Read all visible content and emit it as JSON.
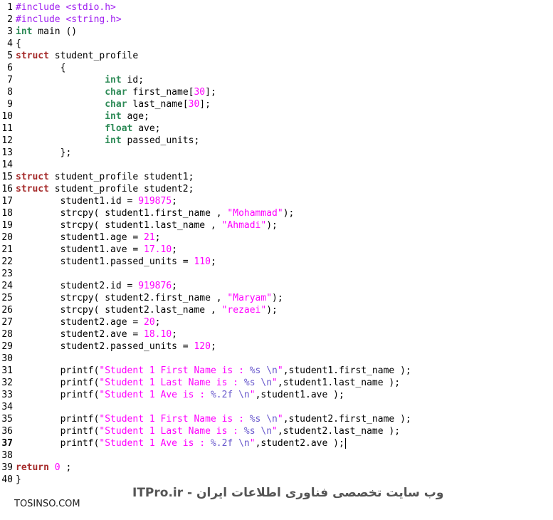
{
  "lines": [
    {
      "n": "1",
      "tokens": [
        {
          "t": "pre",
          "s": "#include <stdio.h>"
        }
      ]
    },
    {
      "n": "2",
      "tokens": [
        {
          "t": "pre",
          "s": "#include <string.h>"
        }
      ]
    },
    {
      "n": "3",
      "tokens": [
        {
          "t": "type",
          "s": "int"
        },
        {
          "t": "id",
          "s": " main ()"
        }
      ]
    },
    {
      "n": "4",
      "tokens": [
        {
          "t": "id",
          "s": "{"
        }
      ]
    },
    {
      "n": "5",
      "tokens": [
        {
          "t": "kw",
          "s": "struct"
        },
        {
          "t": "id",
          "s": " student_profile"
        }
      ]
    },
    {
      "n": "6",
      "tokens": [
        {
          "t": "id",
          "s": "        {"
        }
      ]
    },
    {
      "n": "7",
      "tokens": [
        {
          "t": "id",
          "s": "                "
        },
        {
          "t": "type",
          "s": "int"
        },
        {
          "t": "id",
          "s": " id;"
        }
      ]
    },
    {
      "n": "8",
      "tokens": [
        {
          "t": "id",
          "s": "                "
        },
        {
          "t": "type",
          "s": "char"
        },
        {
          "t": "id",
          "s": " first_name["
        },
        {
          "t": "num",
          "s": "30"
        },
        {
          "t": "id",
          "s": "];"
        }
      ]
    },
    {
      "n": "9",
      "tokens": [
        {
          "t": "id",
          "s": "                "
        },
        {
          "t": "type",
          "s": "char"
        },
        {
          "t": "id",
          "s": " last_name["
        },
        {
          "t": "num",
          "s": "30"
        },
        {
          "t": "id",
          "s": "];"
        }
      ]
    },
    {
      "n": "10",
      "tokens": [
        {
          "t": "id",
          "s": "                "
        },
        {
          "t": "type",
          "s": "int"
        },
        {
          "t": "id",
          "s": " age;"
        }
      ]
    },
    {
      "n": "11",
      "tokens": [
        {
          "t": "id",
          "s": "                "
        },
        {
          "t": "type",
          "s": "float"
        },
        {
          "t": "id",
          "s": " ave;"
        }
      ]
    },
    {
      "n": "12",
      "tokens": [
        {
          "t": "id",
          "s": "                "
        },
        {
          "t": "type",
          "s": "int"
        },
        {
          "t": "id",
          "s": " passed_units;"
        }
      ]
    },
    {
      "n": "13",
      "tokens": [
        {
          "t": "id",
          "s": "        };"
        }
      ]
    },
    {
      "n": "14",
      "tokens": []
    },
    {
      "n": "15",
      "tokens": [
        {
          "t": "kw",
          "s": "struct"
        },
        {
          "t": "id",
          "s": " student_profile student1;"
        }
      ]
    },
    {
      "n": "16",
      "tokens": [
        {
          "t": "kw",
          "s": "struct"
        },
        {
          "t": "id",
          "s": " student_profile student2;"
        }
      ]
    },
    {
      "n": "17",
      "tokens": [
        {
          "t": "id",
          "s": "        student1.id = "
        },
        {
          "t": "num",
          "s": "919875"
        },
        {
          "t": "id",
          "s": ";"
        }
      ]
    },
    {
      "n": "18",
      "tokens": [
        {
          "t": "id",
          "s": "        strcpy( student1.first_name , "
        },
        {
          "t": "str",
          "s": "\"Mohammad\""
        },
        {
          "t": "id",
          "s": ");"
        }
      ]
    },
    {
      "n": "19",
      "tokens": [
        {
          "t": "id",
          "s": "        strcpy( student1.last_name , "
        },
        {
          "t": "str",
          "s": "\"Ahmadi\""
        },
        {
          "t": "id",
          "s": ");"
        }
      ]
    },
    {
      "n": "20",
      "tokens": [
        {
          "t": "id",
          "s": "        student1.age = "
        },
        {
          "t": "num",
          "s": "21"
        },
        {
          "t": "id",
          "s": ";"
        }
      ]
    },
    {
      "n": "21",
      "tokens": [
        {
          "t": "id",
          "s": "        student1.ave = "
        },
        {
          "t": "num",
          "s": "17.10"
        },
        {
          "t": "id",
          "s": ";"
        }
      ]
    },
    {
      "n": "22",
      "tokens": [
        {
          "t": "id",
          "s": "        student1.passed_units = "
        },
        {
          "t": "num",
          "s": "110"
        },
        {
          "t": "id",
          "s": ";"
        }
      ]
    },
    {
      "n": "23",
      "tokens": []
    },
    {
      "n": "24",
      "tokens": [
        {
          "t": "id",
          "s": "        student2.id = "
        },
        {
          "t": "num",
          "s": "919876"
        },
        {
          "t": "id",
          "s": ";"
        }
      ]
    },
    {
      "n": "25",
      "tokens": [
        {
          "t": "id",
          "s": "        strcpy( student2.first_name , "
        },
        {
          "t": "str",
          "s": "\"Maryam\""
        },
        {
          "t": "id",
          "s": ");"
        }
      ]
    },
    {
      "n": "26",
      "tokens": [
        {
          "t": "id",
          "s": "        strcpy( student2.last_name , "
        },
        {
          "t": "str",
          "s": "\"rezaei\""
        },
        {
          "t": "id",
          "s": ");"
        }
      ]
    },
    {
      "n": "27",
      "tokens": [
        {
          "t": "id",
          "s": "        student2.age = "
        },
        {
          "t": "num",
          "s": "20"
        },
        {
          "t": "id",
          "s": ";"
        }
      ]
    },
    {
      "n": "28",
      "tokens": [
        {
          "t": "id",
          "s": "        student2.ave = "
        },
        {
          "t": "num",
          "s": "18.10"
        },
        {
          "t": "id",
          "s": ";"
        }
      ]
    },
    {
      "n": "29",
      "tokens": [
        {
          "t": "id",
          "s": "        student2.passed_units = "
        },
        {
          "t": "num",
          "s": "120"
        },
        {
          "t": "id",
          "s": ";"
        }
      ]
    },
    {
      "n": "30",
      "tokens": []
    },
    {
      "n": "31",
      "tokens": [
        {
          "t": "id",
          "s": "        printf("
        },
        {
          "t": "str",
          "s": "\"Student 1 First Name is : "
        },
        {
          "t": "esc",
          "s": "%s \\n"
        },
        {
          "t": "str",
          "s": "\""
        },
        {
          "t": "id",
          "s": ",student1.first_name );"
        }
      ]
    },
    {
      "n": "32",
      "tokens": [
        {
          "t": "id",
          "s": "        printf("
        },
        {
          "t": "str",
          "s": "\"Student 1 Last Name is : "
        },
        {
          "t": "esc",
          "s": "%s \\n"
        },
        {
          "t": "str",
          "s": "\""
        },
        {
          "t": "id",
          "s": ",student1.last_name );"
        }
      ]
    },
    {
      "n": "33",
      "tokens": [
        {
          "t": "id",
          "s": "        printf("
        },
        {
          "t": "str",
          "s": "\"Student 1 Ave is : "
        },
        {
          "t": "esc",
          "s": "%.2f \\n"
        },
        {
          "t": "str",
          "s": "\""
        },
        {
          "t": "id",
          "s": ",student1.ave );"
        }
      ]
    },
    {
      "n": "34",
      "tokens": []
    },
    {
      "n": "35",
      "tokens": [
        {
          "t": "id",
          "s": "        printf("
        },
        {
          "t": "str",
          "s": "\"Student 1 First Name is : "
        },
        {
          "t": "esc",
          "s": "%s \\n"
        },
        {
          "t": "str",
          "s": "\""
        },
        {
          "t": "id",
          "s": ",student2.first_name );"
        }
      ]
    },
    {
      "n": "36",
      "tokens": [
        {
          "t": "id",
          "s": "        printf("
        },
        {
          "t": "str",
          "s": "\"Student 1 Last Name is : "
        },
        {
          "t": "esc",
          "s": "%s \\n"
        },
        {
          "t": "str",
          "s": "\""
        },
        {
          "t": "id",
          "s": ",student2.last_name );"
        }
      ]
    },
    {
      "n": "37",
      "tokens": [
        {
          "t": "id",
          "s": "        printf("
        },
        {
          "t": "str",
          "s": "\"Student 1 Ave is : "
        },
        {
          "t": "esc",
          "s": "%.2f \\n"
        },
        {
          "t": "str",
          "s": "\""
        },
        {
          "t": "id",
          "s": ",student2.ave );"
        }
      ],
      "cursor": true
    },
    {
      "n": "38",
      "tokens": []
    },
    {
      "n": "39",
      "tokens": [
        {
          "t": "kw",
          "s": "return"
        },
        {
          "t": "id",
          "s": " "
        },
        {
          "t": "num",
          "s": "0"
        },
        {
          "t": "id",
          "s": " ;"
        }
      ]
    },
    {
      "n": "40",
      "tokens": [
        {
          "t": "id",
          "s": "}"
        }
      ]
    }
  ],
  "current_line": "37",
  "watermark": {
    "left_text": "TOSINSO.COM",
    "right_text": "ITPro.ir - وب سایت تخصصی فناوری اطلاعات ایران"
  },
  "colors": {
    "preprocessor": "#a020f0",
    "keyword": "#a52a2a",
    "type": "#2e8b57",
    "number": "#ff00ff",
    "string": "#ff00ff",
    "escape": "#6a5acd"
  }
}
